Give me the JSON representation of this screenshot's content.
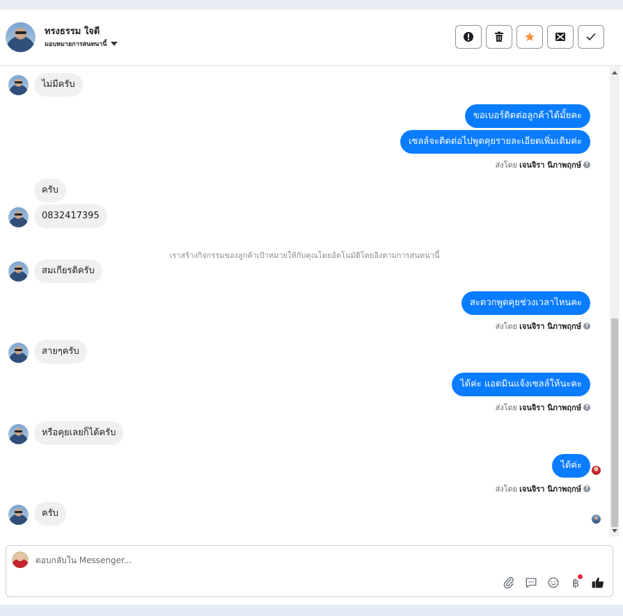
{
  "header": {
    "contact_name": "ทรงธรรม ใจดี",
    "assign_label": "มอบหมายการสนทนานี้",
    "actions": [
      {
        "name": "report",
        "icon": "alert-icon"
      },
      {
        "name": "delete",
        "icon": "trash-icon"
      },
      {
        "name": "star",
        "icon": "star-icon",
        "color": "#f7923a"
      },
      {
        "name": "spam",
        "icon": "mail-x-icon"
      },
      {
        "name": "done",
        "icon": "check-icon"
      }
    ]
  },
  "messages": {
    "m1": "ไม่มีครับ",
    "m2": "ขอเบอร์ติดต่อลูกค้าได้มั้ยคะ",
    "m3": "เซลล์จะติดต่อไปพูดคุยรายละเอียดเพิ่มเติมค่ะ",
    "m4": "ครับ",
    "m5": "0832417395",
    "m6": "สมเกียรติครับ",
    "m7": "สะดวกพูดคุยช่วงเวลาไหนคะ",
    "m8": "สายๆครับ",
    "m9": "ได้ค่ะ แอดมินแจ้งเซลล์ให้นะคะ",
    "m10": "หรือคุยเลยก็ได้ครับ",
    "m11": "ได้ค่ะ",
    "m12": "ครับ",
    "sent_by_prefix": "ส่งโดย",
    "sent_by_name": "เจนจิรา นิภาพฤกษ์",
    "system_note": "เราสร้างกิจกรรมของลูกค้าเป้าหมายให้กับคุณโดยอัตโนมัติโดยอิงตามการสนทนานี้"
  },
  "composer": {
    "placeholder": "ตอบกลับใน Messenger...",
    "tools": [
      "attach-icon",
      "message-icon",
      "emoji-icon",
      "baht-icon",
      "like-icon"
    ],
    "baht_symbol": "฿"
  },
  "colors": {
    "outgoing_bubble": "#0a7cff",
    "incoming_bubble": "#f0f0f0",
    "notification_dot": "#f02849"
  }
}
